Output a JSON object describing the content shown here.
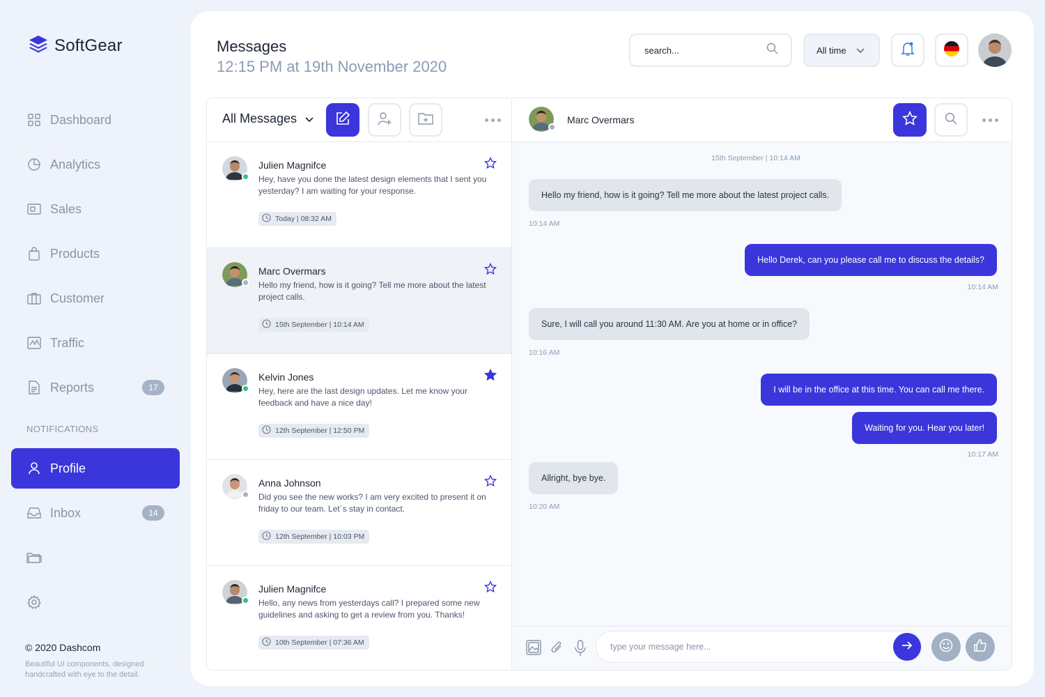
{
  "brand": {
    "name": "SoftGear",
    "accent": "#3a36db"
  },
  "sidebar": {
    "items": [
      {
        "label": "Dashboard",
        "icon": "grid-icon"
      },
      {
        "label": "Analytics",
        "icon": "pie-chart-icon"
      },
      {
        "label": "Sales",
        "icon": "wallet-icon"
      },
      {
        "label": "Products",
        "icon": "shopping-bag-icon"
      },
      {
        "label": "Customer",
        "icon": "briefcase-icon"
      },
      {
        "label": "Traffic",
        "icon": "activity-icon"
      },
      {
        "label": "Reports",
        "icon": "document-icon",
        "badge": "17"
      }
    ],
    "section_label": "NOTIFICATIONS",
    "items2": [
      {
        "label": "Profile",
        "icon": "user-icon",
        "active": true
      },
      {
        "label": "Inbox",
        "icon": "inbox-icon",
        "badge": "14"
      }
    ],
    "extra_icons": [
      "folder-icon",
      "gear-icon"
    ],
    "copyright": "© 2020 Dashcom",
    "tagline": "Beautiful UI components, designed handcrafted with eye to the detail."
  },
  "header": {
    "title": "Messages",
    "subtitle": "12:15 PM at 19th November 2020",
    "search_placeholder": "search...",
    "time_filter": "All time"
  },
  "list": {
    "filter_label": "All Messages",
    "items": [
      {
        "name": "Julien Magnifce",
        "text": "Hey, have you done the latest design elements that I sent you yesterday? I am waiting for your response.",
        "time": "Today | 08:32 AM",
        "starred": false,
        "online": true
      },
      {
        "name": "Marc Overmars",
        "text": "Hello my friend, how is it going? Tell me more about the latest project calls.",
        "time": "15th September | 10:14 AM",
        "starred": false,
        "online": false,
        "selected": true
      },
      {
        "name": "Kelvin Jones",
        "text": "Hey, here are the last design updates. Let me know your feedback and have a nice day!",
        "time": "12th September | 12:50 PM",
        "starred": true,
        "online": true
      },
      {
        "name": "Anna Johnson",
        "text": "Did you see the new works? I am very excited to present it on friday to our team. Let´s stay in contact.",
        "time": "12th September | 10:03 PM",
        "starred": false,
        "online": false
      },
      {
        "name": "Julien Magnifce",
        "text": "Hello, any news from yesterdays call? I prepared some new guidelines and asking to get a review from you. Thanks!",
        "time": "10th September | 07:36 AM",
        "starred": false,
        "online": true
      }
    ]
  },
  "chat": {
    "contact": "Marc Overmars",
    "date_separator": "15th September | 10:14 AM",
    "messages": [
      {
        "dir": "in",
        "text": "Hello my friend, how is it going? Tell me more about the latest project calls.",
        "time": "10:14 AM"
      },
      {
        "dir": "out",
        "text": "Hello Derek, can you please call me to discuss the details?",
        "time": "10:14 AM"
      },
      {
        "dir": "in",
        "text": "Sure, I will call you around 11:30 AM. Are you at home or in office?",
        "time": "10:16 AM"
      },
      {
        "dir": "out",
        "text": "I will be in the office at this time. You can call me there.",
        "time": ""
      },
      {
        "dir": "out",
        "text": "Waiting for you. Hear you later!",
        "time": "10:17 AM"
      },
      {
        "dir": "in",
        "text": "Allright, bye bye.",
        "time": "10:20 AM"
      }
    ],
    "composer_placeholder": "type your message here..."
  }
}
